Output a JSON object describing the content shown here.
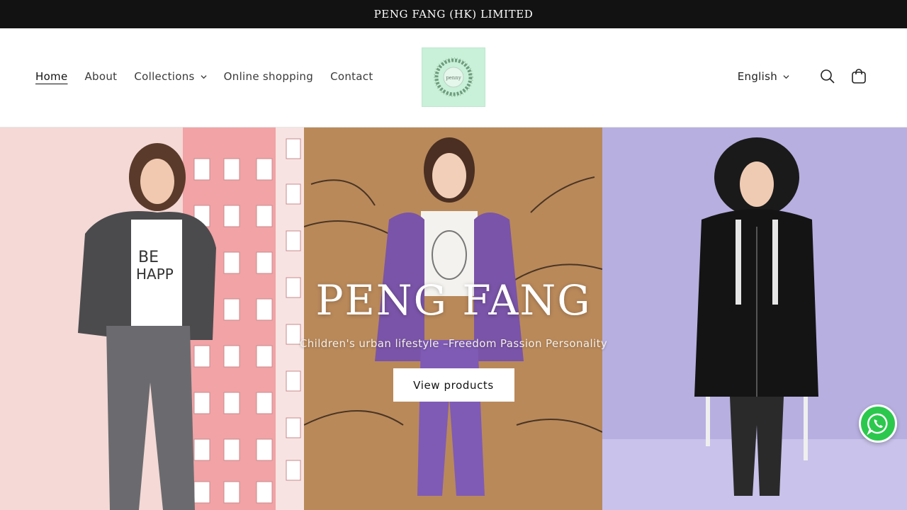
{
  "announcement": {
    "text": "PENG FANG (HK) LIMITED"
  },
  "nav": {
    "items": [
      {
        "label": "Home"
      },
      {
        "label": "About"
      },
      {
        "label": "Collections"
      },
      {
        "label": "Online shopping"
      },
      {
        "label": "Contact"
      }
    ]
  },
  "logo": {
    "text": "penny"
  },
  "header_tools": {
    "language": "English",
    "icons": [
      "search-icon",
      "cart-icon"
    ]
  },
  "hero": {
    "title": "PENG FANG",
    "subtitle": "Children's urban lifestyle –Freedom Passion Personality",
    "button_label": "View products"
  },
  "colors": {
    "announcement_bg": "#121212",
    "panel_left": "#f4d9d6",
    "panel_center": "#b9895a",
    "panel_right": "#b7afe0",
    "logo_bg": "#c9f0d9",
    "whatsapp_green": "#2cc84d"
  },
  "floating": {
    "icon": "whatsapp-icon"
  }
}
